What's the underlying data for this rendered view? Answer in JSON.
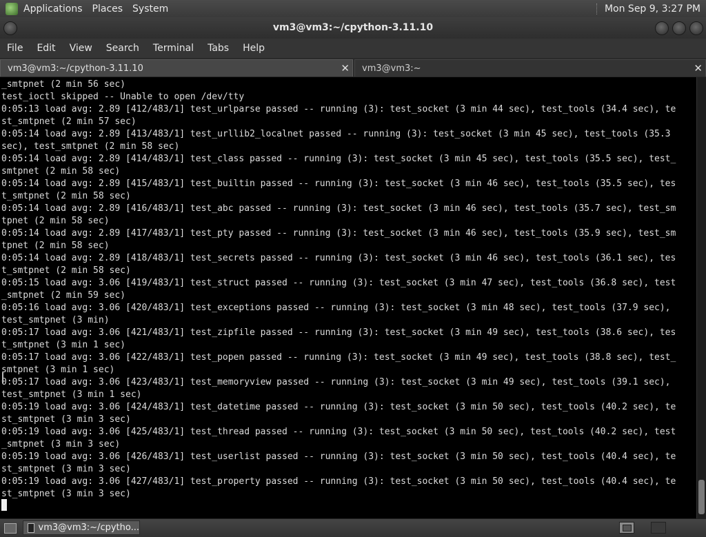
{
  "top_panel": {
    "applications": "Applications",
    "places": "Places",
    "system": "System",
    "clock": "Mon Sep  9,  3:27 PM"
  },
  "window": {
    "title": "vm3@vm3:~/cpython-3.11.10"
  },
  "menubar": {
    "file": "File",
    "edit": "Edit",
    "view": "View",
    "search": "Search",
    "terminal": "Terminal",
    "tabs": "Tabs",
    "help": "Help"
  },
  "tabs": [
    {
      "label": "vm3@vm3:~/cpython-3.11.10",
      "close": "✕"
    },
    {
      "label": "vm3@vm3:~",
      "close": "✕"
    }
  ],
  "terminal": {
    "output": "_smtpnet (2 min 56 sec)\ntest_ioctl skipped -- Unable to open /dev/tty\n0:05:13 load avg: 2.89 [412/483/1] test_urlparse passed -- running (3): test_socket (3 min 44 sec), test_tools (34.4 sec), te\nst_smtpnet (2 min 57 sec)\n0:05:14 load avg: 2.89 [413/483/1] test_urllib2_localnet passed -- running (3): test_socket (3 min 45 sec), test_tools (35.3\nsec), test_smtpnet (2 min 58 sec)\n0:05:14 load avg: 2.89 [414/483/1] test_class passed -- running (3): test_socket (3 min 45 sec), test_tools (35.5 sec), test_\nsmtpnet (2 min 58 sec)\n0:05:14 load avg: 2.89 [415/483/1] test_builtin passed -- running (3): test_socket (3 min 46 sec), test_tools (35.5 sec), tes\nt_smtpnet (2 min 58 sec)\n0:05:14 load avg: 2.89 [416/483/1] test_abc passed -- running (3): test_socket (3 min 46 sec), test_tools (35.7 sec), test_sm\ntpnet (2 min 58 sec)\n0:05:14 load avg: 2.89 [417/483/1] test_pty passed -- running (3): test_socket (3 min 46 sec), test_tools (35.9 sec), test_sm\ntpnet (2 min 58 sec)\n0:05:14 load avg: 2.89 [418/483/1] test_secrets passed -- running (3): test_socket (3 min 46 sec), test_tools (36.1 sec), tes\nt_smtpnet (2 min 58 sec)\n0:05:15 load avg: 3.06 [419/483/1] test_struct passed -- running (3): test_socket (3 min 47 sec), test_tools (36.8 sec), test\n_smtpnet (2 min 59 sec)\n0:05:16 load avg: 3.06 [420/483/1] test_exceptions passed -- running (3): test_socket (3 min 48 sec), test_tools (37.9 sec),\ntest_smtpnet (3 min)\n0:05:17 load avg: 3.06 [421/483/1] test_zipfile passed -- running (3): test_socket (3 min 49 sec), test_tools (38.6 sec), tes\nt_smtpnet (3 min 1 sec)\n0:05:17 load avg: 3.06 [422/483/1] test_popen passed -- running (3): test_socket (3 min 49 sec), test_tools (38.8 sec), test_\nsmtpnet (3 min 1 sec)\n0:05:17 load avg: 3.06 [423/483/1] test_memoryview passed -- running (3): test_socket (3 min 49 sec), test_tools (39.1 sec),\ntest_smtpnet (3 min 1 sec)\n0:05:19 load avg: 3.06 [424/483/1] test_datetime passed -- running (3): test_socket (3 min 50 sec), test_tools (40.2 sec), te\nst_smtpnet (3 min 3 sec)\n0:05:19 load avg: 3.06 [425/483/1] test_thread passed -- running (3): test_socket (3 min 50 sec), test_tools (40.2 sec), test\n_smtpnet (3 min 3 sec)\n0:05:19 load avg: 3.06 [426/483/1] test_userlist passed -- running (3): test_socket (3 min 50 sec), test_tools (40.4 sec), te\nst_smtpnet (3 min 3 sec)\n0:05:19 load avg: 3.06 [427/483/1] test_property passed -- running (3): test_socket (3 min 50 sec), test_tools (40.4 sec), te\nst_smtpnet (3 min 3 sec)"
  },
  "taskbar": {
    "task_label": "vm3@vm3:~/cpytho..."
  },
  "colors": {
    "terminal_bg": "#000000",
    "terminal_fg": "#dcdcdc",
    "panel_bg": "#3a3a3a"
  }
}
